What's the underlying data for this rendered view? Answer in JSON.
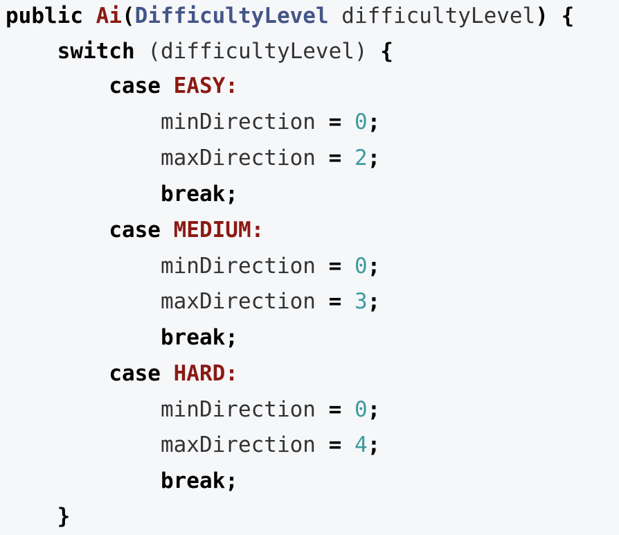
{
  "code": {
    "line1": {
      "kw_public": "public",
      "name": "Ai",
      "open": "(",
      "type": "DifficultyLevel",
      "param": " difficultyLevel",
      "close": ") {"
    },
    "line2": {
      "indent": "    ",
      "kw": "switch",
      "mid": " (difficultyLevel)",
      "close": " {"
    },
    "case_easy": {
      "indent": "        ",
      "kw": "case",
      "label": " EASY:"
    },
    "easy_min": {
      "indent": "            ",
      "lhs": "minDirection ",
      "op": "=",
      "value": "0",
      "semi": ";"
    },
    "easy_max": {
      "indent": "            ",
      "lhs": "maxDirection ",
      "op": "=",
      "value": "2",
      "semi": ";"
    },
    "easy_break": {
      "indent": "            ",
      "kw": "break",
      "semi": ";"
    },
    "case_medium": {
      "indent": "        ",
      "kw": "case",
      "label": " MEDIUM:"
    },
    "medium_min": {
      "indent": "            ",
      "lhs": "minDirection ",
      "op": "=",
      "value": "0",
      "semi": ";"
    },
    "medium_max": {
      "indent": "            ",
      "lhs": "maxDirection ",
      "op": "=",
      "value": "3",
      "semi": ";"
    },
    "medium_break": {
      "indent": "            ",
      "kw": "break",
      "semi": ";"
    },
    "case_hard": {
      "indent": "        ",
      "kw": "case",
      "label": " HARD:"
    },
    "hard_min": {
      "indent": "            ",
      "lhs": "minDirection ",
      "op": "=",
      "value": "0",
      "semi": ";"
    },
    "hard_max": {
      "indent": "            ",
      "lhs": "maxDirection ",
      "op": "=",
      "value": "4",
      "semi": ";"
    },
    "hard_break": {
      "indent": "            ",
      "kw": "break",
      "semi": ";"
    },
    "switch_close": {
      "indent": "    ",
      "brace": "}"
    }
  },
  "colors": {
    "background": "#f6f7f9",
    "keyword": "#000000",
    "method_name": "#8b1a13",
    "type": "#445588",
    "number": "#3c9a9e",
    "text": "#333333"
  }
}
